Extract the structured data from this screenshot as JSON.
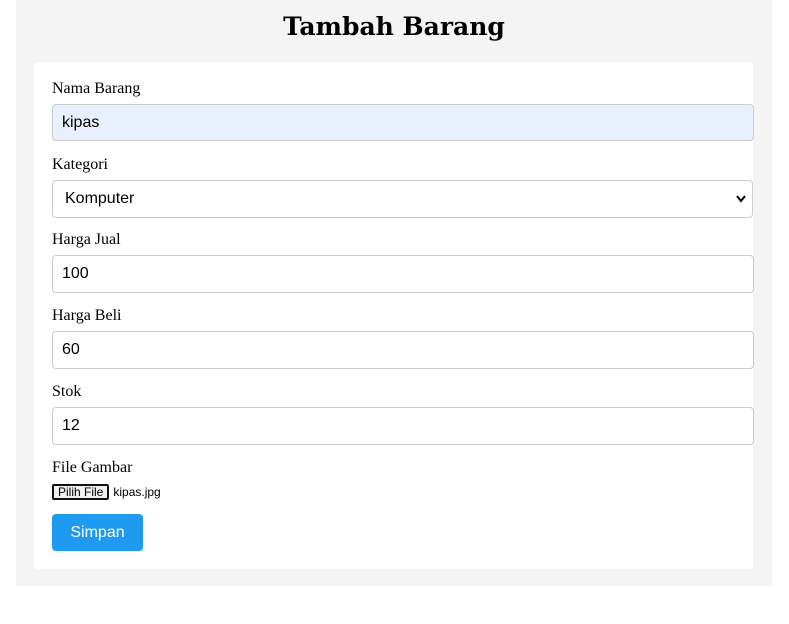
{
  "page_title": "Tambah Barang",
  "form": {
    "nama_barang": {
      "label": "Nama Barang",
      "value": "kipas"
    },
    "kategori": {
      "label": "Kategori",
      "selected": "Komputer"
    },
    "harga_jual": {
      "label": "Harga Jual",
      "value": "100"
    },
    "harga_beli": {
      "label": "Harga Beli",
      "value": "60"
    },
    "stok": {
      "label": "Stok",
      "value": "12"
    },
    "file_gambar": {
      "label": "File Gambar",
      "button_label": "Pilih File",
      "file_name": "kipas.jpg"
    },
    "submit_label": "Simpan"
  },
  "colors": {
    "page_bg": "#ffffff",
    "container_bg": "#f4f4f4",
    "card_bg": "#ffffff",
    "autofill_bg": "#e8f0fe",
    "submit_bg": "#1e9bf0",
    "border": "#cccccc"
  },
  "icons": {
    "select_arrow": "chevron-down-icon"
  }
}
